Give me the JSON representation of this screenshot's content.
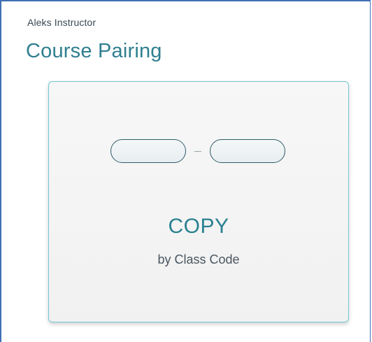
{
  "header": {
    "eyebrow": "Aleks Instructor",
    "title": "Course Pairing"
  },
  "card": {
    "title": "COPY",
    "subtitle": "by Class Code",
    "graphic": "class-code-input-icon"
  },
  "colors": {
    "title": "#2f7f8f",
    "card_border": "#72c6d3",
    "frame_border": "#3f6fb5"
  }
}
